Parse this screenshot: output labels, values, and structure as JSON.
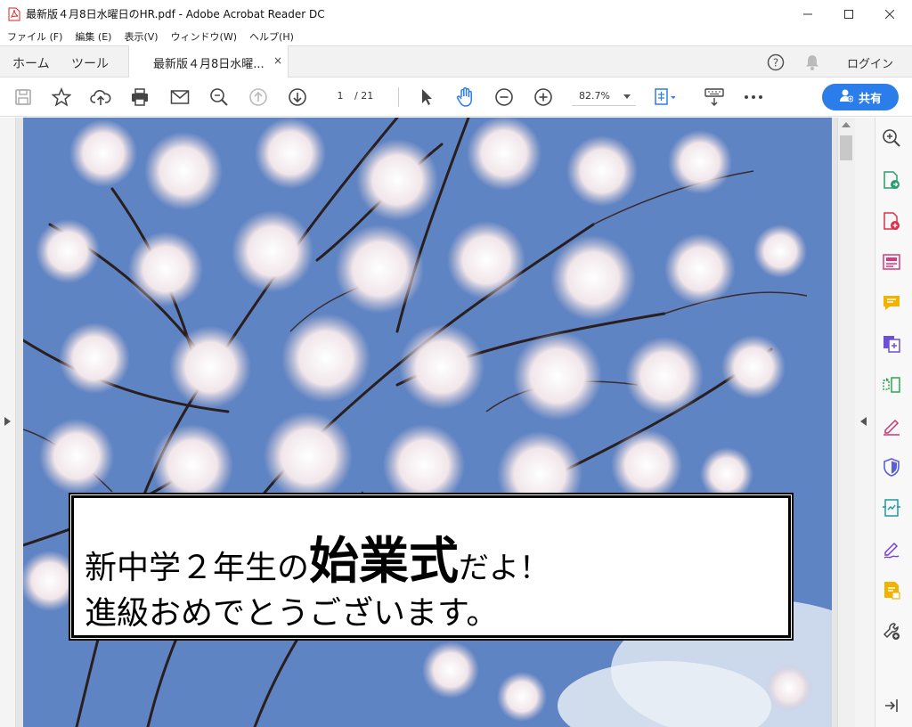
{
  "window": {
    "title": "最新版４月8日水曜日のHR.pdf - Adobe Acrobat Reader DC"
  },
  "menu": [
    "ファイル (F)",
    "編集 (E)",
    "表示(V)",
    "ウィンドウ(W)",
    "ヘルプ(H)"
  ],
  "tabs": {
    "home": "ホーム",
    "tools": "ツール",
    "document": "最新版４月8日水曜...",
    "close": "×"
  },
  "header": {
    "login": "ログイン"
  },
  "toolbar": {
    "page_current": "1",
    "page_total": "/ 21",
    "zoom": "82.7%",
    "share_label": "共有"
  },
  "document": {
    "banner_line1_a": "新中学２年生の",
    "banner_line1_b": "始業式",
    "banner_line1_c": "だよ！",
    "banner_line2": "進級おめでとうございます。"
  },
  "colors": {
    "accent": "#2b7de9",
    "sky": "#5a7fc0"
  }
}
